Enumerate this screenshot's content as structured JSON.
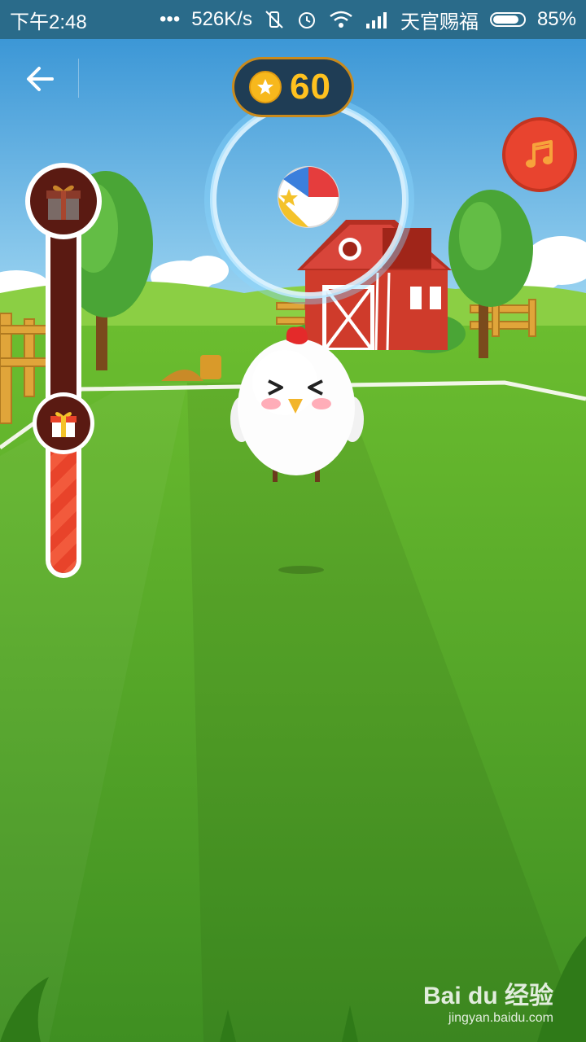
{
  "status_bar": {
    "time": "下午2:48",
    "dots": "•••",
    "net_speed": "526K/s",
    "carrier": "天官赐福",
    "battery_percent": "85%",
    "battery_level": 0.85,
    "icons": [
      "mute-vibrate-icon",
      "alarm-icon",
      "wifi-icon",
      "signal-icon",
      "battery-icon"
    ]
  },
  "game": {
    "coins": "60",
    "back_icon": "arrow-left-icon",
    "music_icon": "music-note-icon",
    "reward_progress": 0.4,
    "colors": {
      "coin": "#f7b81d",
      "progress": "#f25a3c",
      "track": "#5a1a12",
      "music": "#e8442f"
    }
  },
  "watermark": {
    "brand": "Bai du 经验",
    "url": "jingyan.baidu.com"
  }
}
